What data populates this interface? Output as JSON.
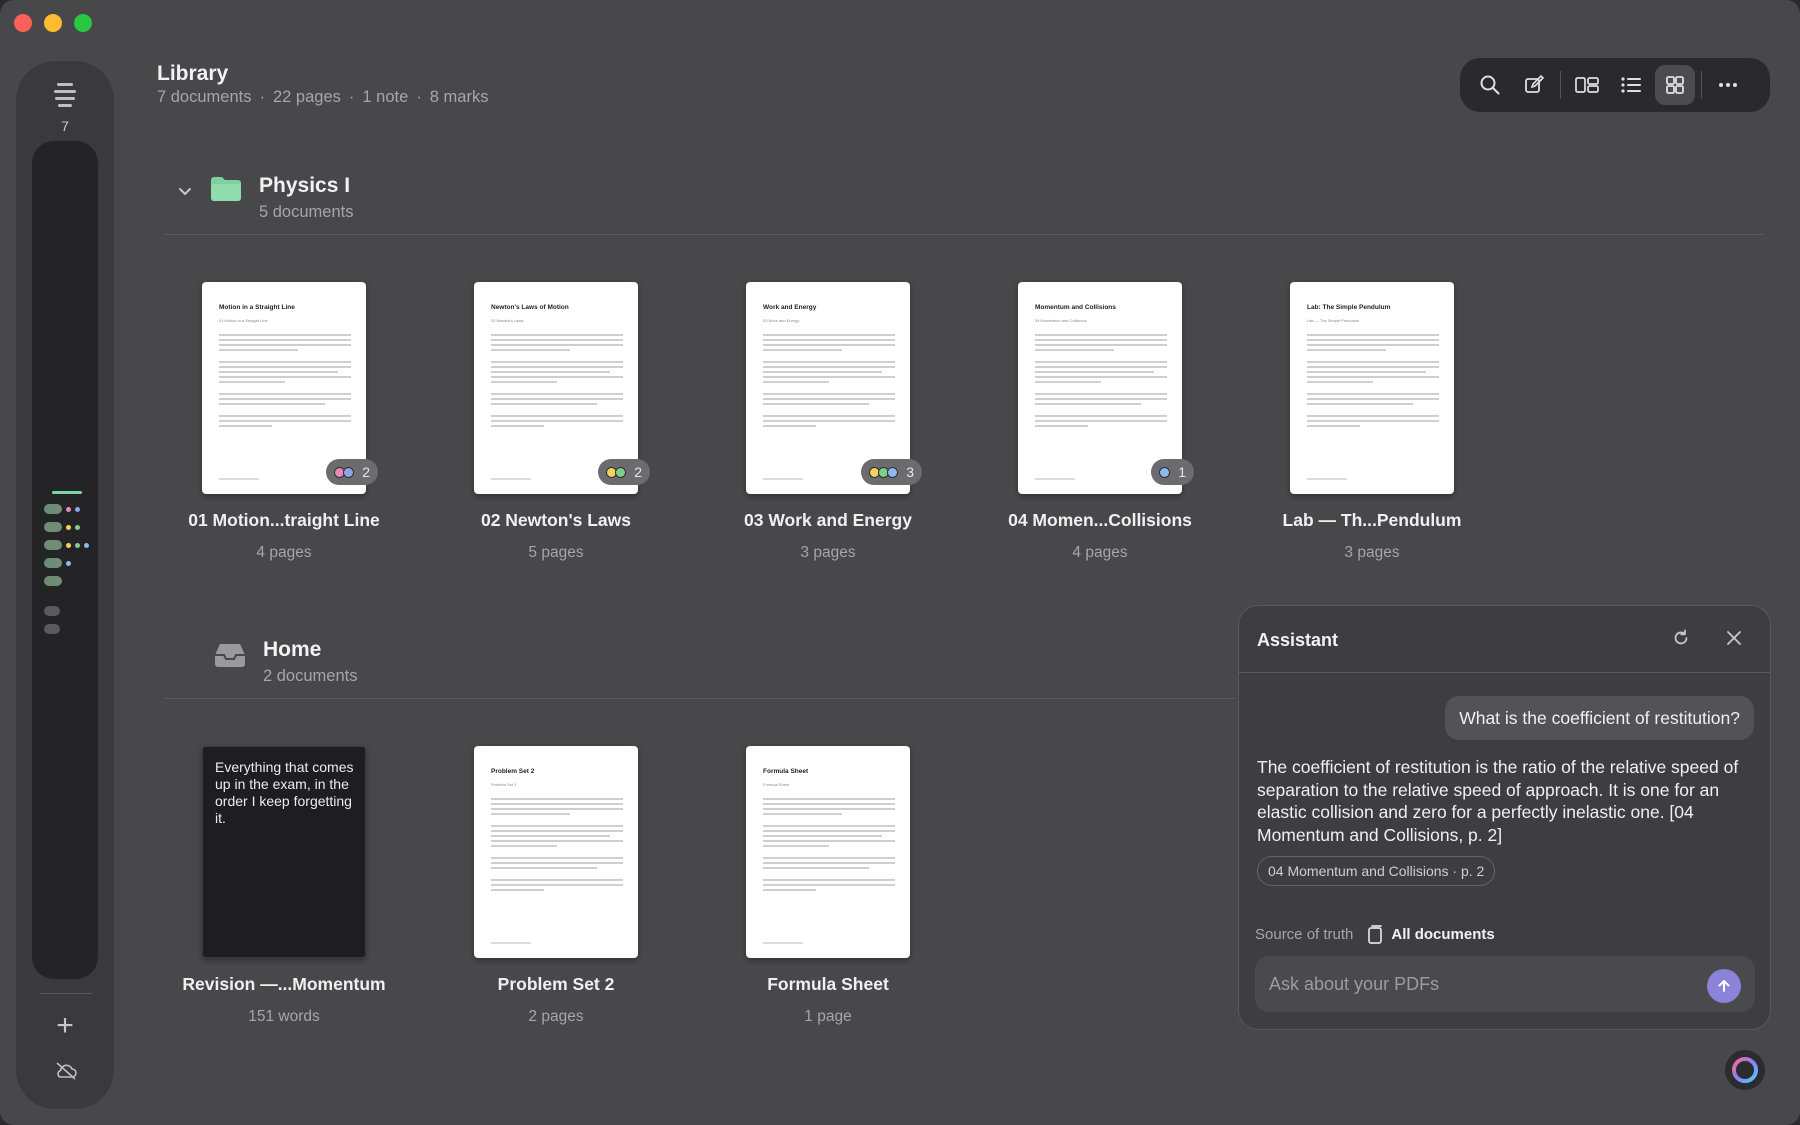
{
  "window": {
    "traffic_lights": [
      "close",
      "minimize",
      "zoom"
    ]
  },
  "rail": {
    "count": "7",
    "icon_top": "stack-icon",
    "add_label": "+",
    "icon_bottom": "cloud-off-icon"
  },
  "header": {
    "title": "Library",
    "stats": [
      "7 documents",
      "22 pages",
      "1 note",
      "8 marks"
    ]
  },
  "toolbar": {
    "buttons": [
      "search-icon",
      "compose-icon",
      "sidebar-layout-icon",
      "list-view-icon",
      "grid-view-icon",
      "more-icon"
    ],
    "active": "grid-view-icon"
  },
  "sections": [
    {
      "title": "Physics I",
      "subtitle": "5 documents",
      "icon": "folder-icon",
      "docs": [
        {
          "name": "01 Motion...traight Line",
          "meta": "4 pages",
          "page_title": "Motion in a Straight Line",
          "page_sub": "01 Motion in a Straight Line",
          "badge_count": "2",
          "badge_colors": [
            "#e78ab6",
            "#8fa4e8"
          ]
        },
        {
          "name": "02 Newton's Laws",
          "meta": "5 pages",
          "page_title": "Newton's Laws of Motion",
          "page_sub": "02 Newton's Laws",
          "badge_count": "2",
          "badge_colors": [
            "#f2d45c",
            "#7fcf8a"
          ]
        },
        {
          "name": "03 Work and Energy",
          "meta": "3 pages",
          "page_title": "Work and Energy",
          "page_sub": "03 Work and Energy",
          "badge_count": "3",
          "badge_colors": [
            "#f2d45c",
            "#7fcf8a",
            "#8fb8ee"
          ]
        },
        {
          "name": "04 Momen...Collisions",
          "meta": "4 pages",
          "page_title": "Momentum and Collisions",
          "page_sub": "04 Momentum and Collisions",
          "badge_count": "1",
          "badge_colors": [
            "#8fb8ee"
          ]
        },
        {
          "name": "Lab — Th...Pendulum",
          "meta": "3 pages",
          "page_title": "Lab: The Simple Pendulum",
          "page_sub": "Lab — The Simple Pendulum",
          "badge_count": "",
          "badge_colors": []
        }
      ]
    },
    {
      "title": "Home",
      "subtitle": "2 documents",
      "icon": "inbox-icon",
      "docs": [
        {
          "name": "Revision —...Momentum",
          "meta": "151 words",
          "note_text": "Everything that comes up in the exam, in the order I keep forgetting it."
        },
        {
          "name": "Problem Set 2",
          "meta": "2 pages",
          "page_title": "Problem Set 2",
          "page_sub": "Problem Set 2"
        },
        {
          "name": "Formula Sheet",
          "meta": "1 page",
          "page_title": "Formula Sheet",
          "page_sub": "Formula Sheet"
        }
      ]
    }
  ],
  "assistant": {
    "title": "Assistant",
    "user_message": "What is the coefficient of restitution?",
    "reply": "The coefficient of restitution is the ratio of the relative speed of separation to the relative speed of approach. It is one for an elastic collision and zero for a perfectly inelastic one. [04 Momentum and Collisions, p. 2]",
    "citation": "04 Momentum and Collisions · p. 2",
    "source_label": "Source of truth",
    "source_value": "All documents",
    "input_placeholder": "Ask about your PDFs"
  },
  "colors": {
    "accent_send": "#8b82d9",
    "folder_green": "#7fcfa0",
    "rail_accent": "#7ad3a4"
  }
}
